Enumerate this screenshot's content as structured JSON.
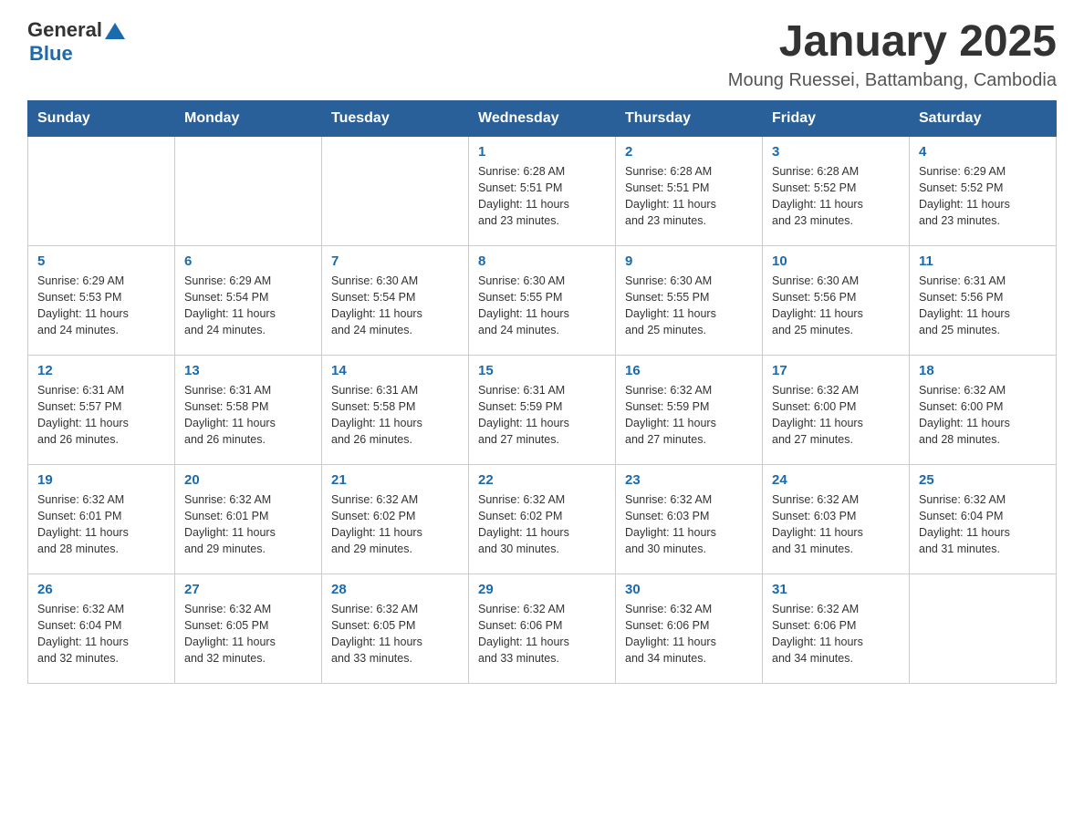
{
  "header": {
    "logo_general": "General",
    "logo_blue": "Blue",
    "title": "January 2025",
    "subtitle": "Moung Ruessei, Battambang, Cambodia"
  },
  "days_of_week": [
    "Sunday",
    "Monday",
    "Tuesday",
    "Wednesday",
    "Thursday",
    "Friday",
    "Saturday"
  ],
  "weeks": [
    [
      {
        "day": "",
        "info": ""
      },
      {
        "day": "",
        "info": ""
      },
      {
        "day": "",
        "info": ""
      },
      {
        "day": "1",
        "info": "Sunrise: 6:28 AM\nSunset: 5:51 PM\nDaylight: 11 hours\nand 23 minutes."
      },
      {
        "day": "2",
        "info": "Sunrise: 6:28 AM\nSunset: 5:51 PM\nDaylight: 11 hours\nand 23 minutes."
      },
      {
        "day": "3",
        "info": "Sunrise: 6:28 AM\nSunset: 5:52 PM\nDaylight: 11 hours\nand 23 minutes."
      },
      {
        "day": "4",
        "info": "Sunrise: 6:29 AM\nSunset: 5:52 PM\nDaylight: 11 hours\nand 23 minutes."
      }
    ],
    [
      {
        "day": "5",
        "info": "Sunrise: 6:29 AM\nSunset: 5:53 PM\nDaylight: 11 hours\nand 24 minutes."
      },
      {
        "day": "6",
        "info": "Sunrise: 6:29 AM\nSunset: 5:54 PM\nDaylight: 11 hours\nand 24 minutes."
      },
      {
        "day": "7",
        "info": "Sunrise: 6:30 AM\nSunset: 5:54 PM\nDaylight: 11 hours\nand 24 minutes."
      },
      {
        "day": "8",
        "info": "Sunrise: 6:30 AM\nSunset: 5:55 PM\nDaylight: 11 hours\nand 24 minutes."
      },
      {
        "day": "9",
        "info": "Sunrise: 6:30 AM\nSunset: 5:55 PM\nDaylight: 11 hours\nand 25 minutes."
      },
      {
        "day": "10",
        "info": "Sunrise: 6:30 AM\nSunset: 5:56 PM\nDaylight: 11 hours\nand 25 minutes."
      },
      {
        "day": "11",
        "info": "Sunrise: 6:31 AM\nSunset: 5:56 PM\nDaylight: 11 hours\nand 25 minutes."
      }
    ],
    [
      {
        "day": "12",
        "info": "Sunrise: 6:31 AM\nSunset: 5:57 PM\nDaylight: 11 hours\nand 26 minutes."
      },
      {
        "day": "13",
        "info": "Sunrise: 6:31 AM\nSunset: 5:58 PM\nDaylight: 11 hours\nand 26 minutes."
      },
      {
        "day": "14",
        "info": "Sunrise: 6:31 AM\nSunset: 5:58 PM\nDaylight: 11 hours\nand 26 minutes."
      },
      {
        "day": "15",
        "info": "Sunrise: 6:31 AM\nSunset: 5:59 PM\nDaylight: 11 hours\nand 27 minutes."
      },
      {
        "day": "16",
        "info": "Sunrise: 6:32 AM\nSunset: 5:59 PM\nDaylight: 11 hours\nand 27 minutes."
      },
      {
        "day": "17",
        "info": "Sunrise: 6:32 AM\nSunset: 6:00 PM\nDaylight: 11 hours\nand 27 minutes."
      },
      {
        "day": "18",
        "info": "Sunrise: 6:32 AM\nSunset: 6:00 PM\nDaylight: 11 hours\nand 28 minutes."
      }
    ],
    [
      {
        "day": "19",
        "info": "Sunrise: 6:32 AM\nSunset: 6:01 PM\nDaylight: 11 hours\nand 28 minutes."
      },
      {
        "day": "20",
        "info": "Sunrise: 6:32 AM\nSunset: 6:01 PM\nDaylight: 11 hours\nand 29 minutes."
      },
      {
        "day": "21",
        "info": "Sunrise: 6:32 AM\nSunset: 6:02 PM\nDaylight: 11 hours\nand 29 minutes."
      },
      {
        "day": "22",
        "info": "Sunrise: 6:32 AM\nSunset: 6:02 PM\nDaylight: 11 hours\nand 30 minutes."
      },
      {
        "day": "23",
        "info": "Sunrise: 6:32 AM\nSunset: 6:03 PM\nDaylight: 11 hours\nand 30 minutes."
      },
      {
        "day": "24",
        "info": "Sunrise: 6:32 AM\nSunset: 6:03 PM\nDaylight: 11 hours\nand 31 minutes."
      },
      {
        "day": "25",
        "info": "Sunrise: 6:32 AM\nSunset: 6:04 PM\nDaylight: 11 hours\nand 31 minutes."
      }
    ],
    [
      {
        "day": "26",
        "info": "Sunrise: 6:32 AM\nSunset: 6:04 PM\nDaylight: 11 hours\nand 32 minutes."
      },
      {
        "day": "27",
        "info": "Sunrise: 6:32 AM\nSunset: 6:05 PM\nDaylight: 11 hours\nand 32 minutes."
      },
      {
        "day": "28",
        "info": "Sunrise: 6:32 AM\nSunset: 6:05 PM\nDaylight: 11 hours\nand 33 minutes."
      },
      {
        "day": "29",
        "info": "Sunrise: 6:32 AM\nSunset: 6:06 PM\nDaylight: 11 hours\nand 33 minutes."
      },
      {
        "day": "30",
        "info": "Sunrise: 6:32 AM\nSunset: 6:06 PM\nDaylight: 11 hours\nand 34 minutes."
      },
      {
        "day": "31",
        "info": "Sunrise: 6:32 AM\nSunset: 6:06 PM\nDaylight: 11 hours\nand 34 minutes."
      },
      {
        "day": "",
        "info": ""
      }
    ]
  ]
}
